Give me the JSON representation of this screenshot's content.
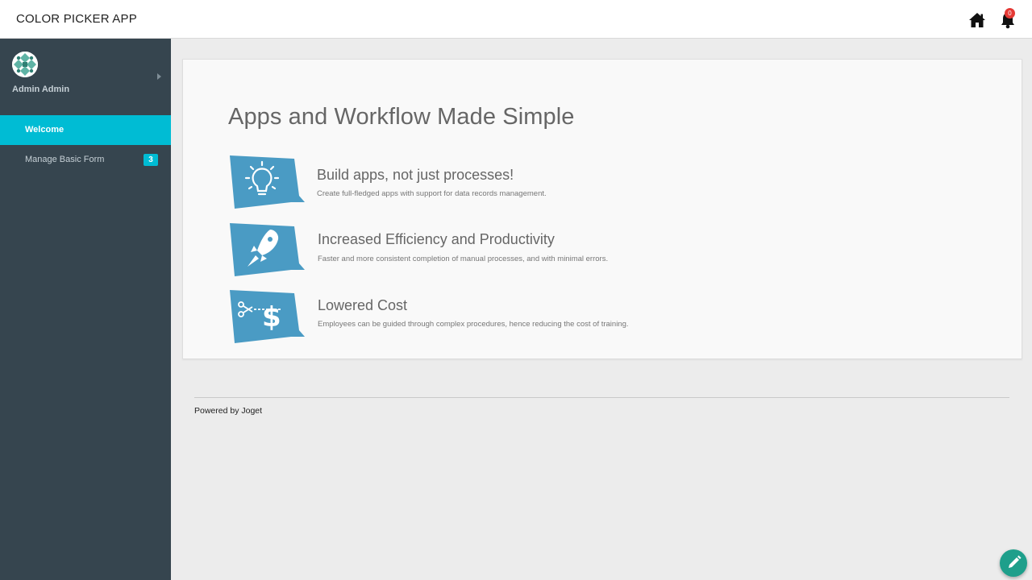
{
  "header": {
    "app_title": "COLOR PICKER APP",
    "home_icon": "home-icon",
    "notifications_icon": "bell-icon",
    "notifications_count": "0"
  },
  "sidebar": {
    "user_name": "Admin Admin",
    "menu": [
      {
        "label": "Welcome",
        "active": true
      },
      {
        "label": "Manage Basic Form",
        "badge": "3",
        "active": false
      }
    ]
  },
  "main": {
    "title": "Apps and Workflow Made Simple",
    "features": [
      {
        "icon": "lightbulb-icon",
        "title": "Build apps, not just processes!",
        "desc": "Create full-fledged apps with support for data records management."
      },
      {
        "icon": "rocket-icon",
        "title": "Increased Efficiency and Productivity",
        "desc": "Faster and more consistent completion of manual processes, and with minimal errors."
      },
      {
        "icon": "scissors-dollar-icon",
        "title": "Lowered Cost",
        "desc": "Employees can be guided through complex procedures, hence reducing the cost of training."
      }
    ]
  },
  "footer": {
    "powered_by": "Powered by Joget"
  },
  "colors": {
    "accent": "#00bcd4",
    "sidebar_bg": "#36454f",
    "feature_icon_bg": "#4a9bc4",
    "fab": "#1e9f8b",
    "badge_red": "#e53935"
  }
}
